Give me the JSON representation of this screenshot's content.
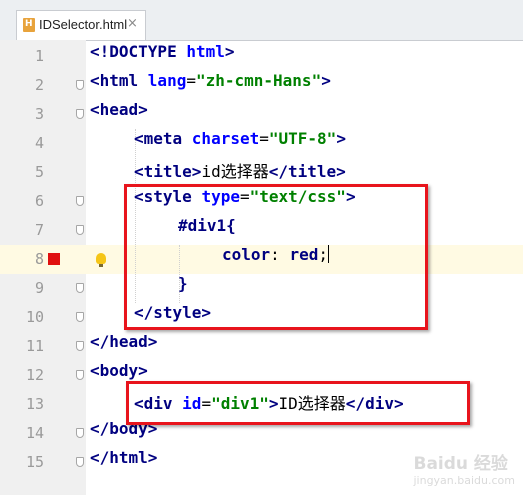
{
  "tab": {
    "filename": "IDSelector.html",
    "close": "×",
    "icon": "html-file-icon"
  },
  "gutter": {
    "line_numbers": [
      "1",
      "2",
      "3",
      "4",
      "5",
      "6",
      "7",
      "8",
      "9",
      "10",
      "11",
      "12",
      "13",
      "14",
      "15"
    ],
    "breakpoint_line": "8",
    "current_line": "8"
  },
  "code": {
    "l1": {
      "a": "<!DOCTYPE ",
      "b": "html",
      "c": ">"
    },
    "l2": {
      "a": "<html ",
      "b": "lang",
      "c": "=",
      "d": "\"zh-cmn-Hans\"",
      "e": ">"
    },
    "l3": {
      "a": "<head>"
    },
    "l4": {
      "a": "<meta ",
      "b": "charset",
      "c": "=",
      "d": "\"UTF-8\"",
      "e": ">"
    },
    "l5": {
      "a": "<title>",
      "b": "id选择器",
      "c": "</title>"
    },
    "l6": {
      "a": "<style ",
      "b": "type",
      "c": "=",
      "d": "\"text/css\"",
      "e": ">"
    },
    "l7": {
      "a": "#div1{"
    },
    "l8": {
      "a": "color",
      "b": ": ",
      "c": "red",
      "d": ";"
    },
    "l9": {
      "a": "}"
    },
    "l10": {
      "a": "</style>"
    },
    "l11": {
      "a": "</head>"
    },
    "l12": {
      "a": "<body>"
    },
    "l13": {
      "a": "<div ",
      "b": "id",
      "c": "=",
      "d": "\"div1\"",
      "e": ">",
      "f": "ID选择器",
      "g": "</div>"
    },
    "l14": {
      "a": "</body>"
    },
    "l15": {
      "a": "</html>"
    }
  },
  "colors": {
    "highlight_box": "#e8141c",
    "current_line_bg": "#fffae3",
    "tag": "#000080",
    "attr_value": "#008000",
    "attr_name": "#0000ff"
  },
  "watermark": {
    "line1": "Baidu 经验",
    "line2": "jingyan.baidu.com"
  }
}
